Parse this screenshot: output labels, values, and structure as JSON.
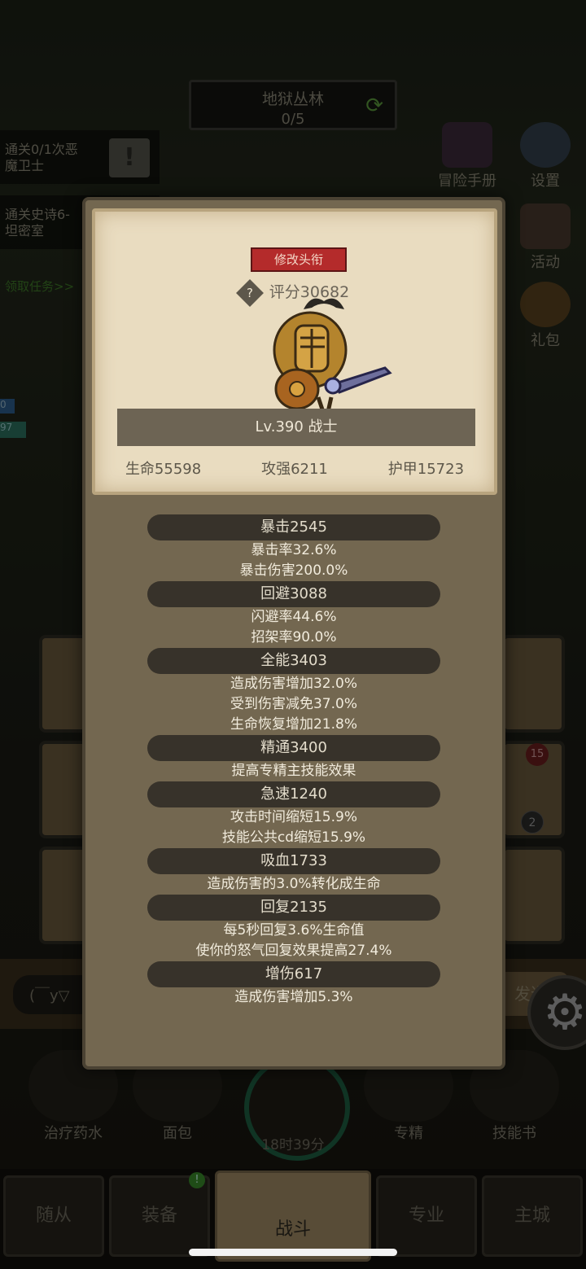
{
  "zone": {
    "name": "地狱丛林",
    "progress": "0/5"
  },
  "quests": [
    {
      "line1": "通关0/1次恶",
      "line2": "魔卫士",
      "button": "!"
    },
    {
      "line1": "通关史诗6-",
      "line2": "坦密室"
    }
  ],
  "quest_link": "领取任务>>",
  "side_buttons": [
    {
      "label": "冒险手册",
      "icon": "book-icon"
    },
    {
      "label": "设置",
      "icon": "gear-icon"
    },
    {
      "label": "活动",
      "icon": "scroll-icon"
    },
    {
      "label": "礼包",
      "icon": "gift-icon"
    }
  ],
  "hp_labels": [
    "0",
    "97"
  ],
  "badges": {
    "red": "15",
    "dark": "2",
    "green": "!"
  },
  "chat": {
    "placeholder": "(￣y▽",
    "send": "发送"
  },
  "actions": [
    {
      "label": "治疗药水",
      "icon": "potion-icon"
    },
    {
      "label": "面包",
      "icon": "bread-icon"
    },
    {
      "label": "专精",
      "icon": "mastery-icon"
    },
    {
      "label": "技能书",
      "icon": "skillbook-icon"
    }
  ],
  "chest_timer": "18时39分",
  "bottom_tabs": [
    "随从",
    "装备",
    "战斗",
    "专业",
    "主城"
  ],
  "hero_card": {
    "title_button": "修改头衔",
    "score_label": "评分30682",
    "level_line": "Lv.390 战士",
    "hp": "生命55598",
    "attack": "攻强6211",
    "armor": "护甲15723"
  },
  "stats": [
    {
      "title": "暴击2545",
      "details": [
        "暴击率32.6%",
        "暴击伤害200.0%"
      ]
    },
    {
      "title": "回避3088",
      "details": [
        "闪避率44.6%",
        "招架率90.0%"
      ]
    },
    {
      "title": "全能3403",
      "details": [
        "造成伤害增加32.0%",
        "受到伤害减免37.0%",
        "生命恢复增加21.8%"
      ]
    },
    {
      "title": "精通3400",
      "details": [
        "提高专精主技能效果"
      ]
    },
    {
      "title": "急速1240",
      "details": [
        "攻击时间缩短15.9%",
        "技能公共cd缩短15.9%"
      ]
    },
    {
      "title": "吸血1733",
      "details": [
        "造成伤害的3.0%转化成生命"
      ]
    },
    {
      "title": "回复2135",
      "details": [
        "每5秒回复3.6%生命值",
        "使你的怒气回复效果提高27.4%"
      ]
    },
    {
      "title": "增伤617",
      "details": [
        "造成伤害增加5.3%"
      ]
    }
  ],
  "colors": {
    "accent_red": "#b42b2b",
    "parchment": "#e9dcc0",
    "modal_bg": "#736750",
    "pill": "#37322a"
  }
}
